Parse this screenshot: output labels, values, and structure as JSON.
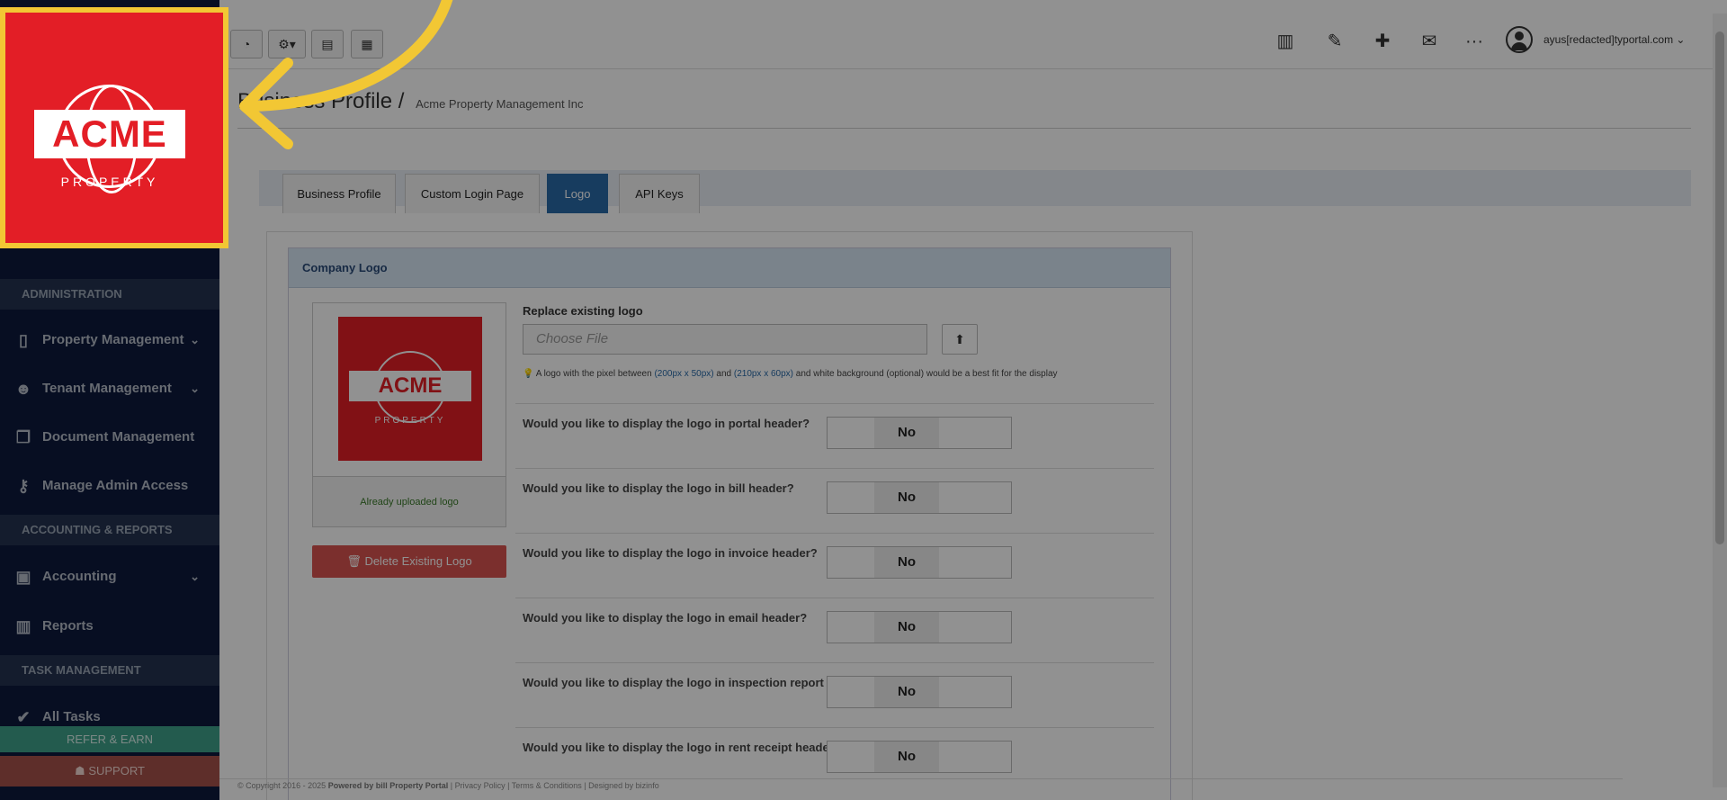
{
  "brand": {
    "logo_text": "ACME",
    "logo_sub": "PROPERTY",
    "accent": "#e31e26",
    "highlight": "#f2c734"
  },
  "sidebar": {
    "sections": [
      {
        "label": "ADMINISTRATION"
      },
      {
        "label": "ACCOUNTING & REPORTS"
      },
      {
        "label": "TASK MANAGEMENT"
      }
    ],
    "items": [
      {
        "label": "Property Management",
        "icon": "building-icon",
        "has_chevron": true
      },
      {
        "label": "Tenant Management",
        "icon": "users-icon",
        "has_chevron": true
      },
      {
        "label": "Document Management",
        "icon": "documents-icon",
        "has_chevron": false
      },
      {
        "label": "Manage Admin Access",
        "icon": "key-icon",
        "has_chevron": false
      },
      {
        "label": "Accounting",
        "icon": "money-icon",
        "has_chevron": true
      },
      {
        "label": "Reports",
        "icon": "bar-chart-icon",
        "has_chevron": false
      },
      {
        "label": "All Tasks",
        "icon": "check-icon",
        "has_chevron": false
      }
    ],
    "refer_label": "REFER & EARN",
    "support_label": "SUPPORT"
  },
  "topbar": {
    "buttons": [
      "dashboard-icon",
      "gear-dropdown-icon",
      "calendar-check-icon",
      "calculator-icon"
    ],
    "icons": [
      "bar-chart-icon",
      "wrench-icon",
      "plus-icon",
      "envelope-icon",
      "more-icon"
    ],
    "user_email": "ayus[redacted]typortal.com"
  },
  "breadcrumb": {
    "title": "Business Profile",
    "current": "Acme Property Management Inc"
  },
  "tabs": [
    {
      "label": "Business Profile",
      "active": false
    },
    {
      "label": "Custom Login Page",
      "active": false
    },
    {
      "label": "Logo",
      "active": true
    },
    {
      "label": "API Keys",
      "active": false
    }
  ],
  "card": {
    "title": "Company Logo",
    "thumb_caption": "Already uploaded logo",
    "delete_label": "Delete Existing Logo",
    "replace_label": "Replace existing logo",
    "file_placeholder": "Choose File",
    "hint_prefix": "A logo with the pixel between ",
    "hint_size1": "(200px x 50px)",
    "hint_mid": " and ",
    "hint_size2": "(210px x 60px)",
    "hint_suffix": " and white background (optional) would be a best fit for the display",
    "questions": [
      {
        "label": "Would you like to display the logo in portal header?",
        "value": "No"
      },
      {
        "label": "Would you like to display the logo in bill header?",
        "value": "No"
      },
      {
        "label": "Would you like to display the logo in invoice header?",
        "value": "No"
      },
      {
        "label": "Would you like to display the logo in email header?",
        "value": "No"
      },
      {
        "label": "Would you like to display the logo in inspection report header?",
        "value": "No"
      },
      {
        "label": "Would you like to display the logo in rent receipt header?",
        "value": "No"
      }
    ]
  },
  "footer": {
    "copyright": "© Copyright 2016 - 2025 ",
    "powered": "Powered by bill Property Portal",
    "links": " | Privacy Policy | Terms & Conditions | Designed by bizinfo"
  }
}
